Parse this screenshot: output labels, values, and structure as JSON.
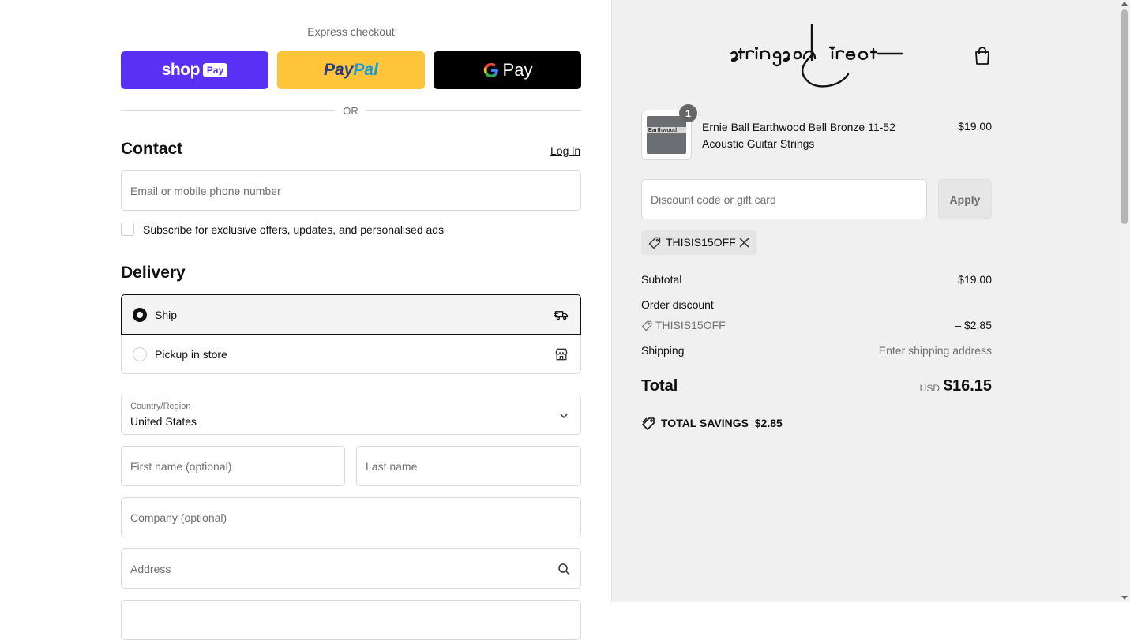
{
  "express": {
    "title": "Express checkout",
    "shop_pay": {
      "word": "shop",
      "badge": "Pay"
    },
    "paypal": {
      "part1": "Pay",
      "part2": "Pal"
    },
    "gpay": {
      "g": "G",
      "text": "Pay"
    },
    "or": "OR"
  },
  "contact": {
    "heading": "Contact",
    "login": "Log in",
    "email_placeholder": "Email or mobile phone number",
    "subscribe_label": "Subscribe for exclusive offers, updates, and personalised ads"
  },
  "delivery": {
    "heading": "Delivery",
    "options": [
      {
        "label": "Ship",
        "selected": true,
        "icon": "truck-icon"
      },
      {
        "label": "Pickup in store",
        "selected": false,
        "icon": "store-icon"
      }
    ],
    "country_label": "Country/Region",
    "country_value": "United States",
    "first_name_placeholder": "First name (optional)",
    "last_name_placeholder": "Last name",
    "company_placeholder": "Company (optional)",
    "address_placeholder": "Address"
  },
  "summary": {
    "product": {
      "thumb_text": "Earthwood",
      "quantity": "1",
      "name": "Ernie Ball Earthwood Bell Bronze 11-52 Acoustic Guitar Strings",
      "price": "$19.00"
    },
    "discount_placeholder": "Discount code or gift card",
    "apply_label": "Apply",
    "applied_code": "THISIS15OFF",
    "subtotal_label": "Subtotal",
    "subtotal_value": "$19.00",
    "order_discount_label": "Order discount",
    "discount_code": "THISIS15OFF",
    "discount_amount": "– $2.85",
    "shipping_label": "Shipping",
    "shipping_value": "Enter shipping address",
    "total_label": "Total",
    "currency": "USD",
    "total_value": "$16.15",
    "savings_label": "TOTAL SAVINGS",
    "savings_value": "$2.85"
  },
  "colors": {
    "shop_pay": "#5a31f4",
    "paypal": "#ffc439",
    "gpay": "#000000",
    "summary_bg": "#f0f0f0"
  }
}
